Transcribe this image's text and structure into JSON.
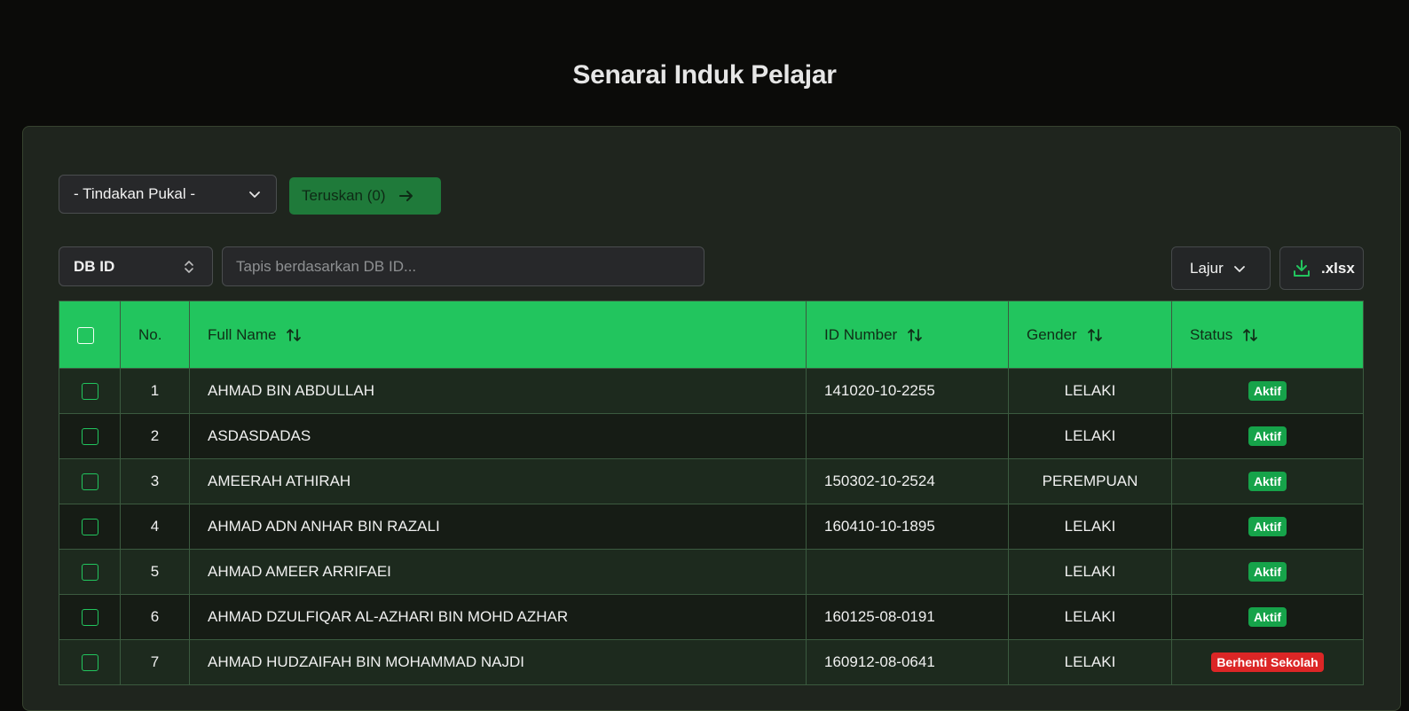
{
  "header": {
    "title": "Senarai Induk Pelajar"
  },
  "bulk": {
    "select_label": "- Tindakan Pukal -",
    "go_label": "Teruskan (0)"
  },
  "filter": {
    "field_label": "DB ID",
    "placeholder": "Tapis berdasarkan DB ID..."
  },
  "toolbar": {
    "columns_label": "Lajur",
    "export_label": ".xlsx"
  },
  "table": {
    "columns": {
      "no": "No.",
      "name": "Full Name",
      "id": "ID Number",
      "gender": "Gender",
      "status": "Status"
    },
    "rows": [
      {
        "no": "1",
        "name": "AHMAD BIN ABDULLAH",
        "id": "141020-10-2255",
        "gender": "LELAKI",
        "status": "Aktif"
      },
      {
        "no": "2",
        "name": "ASDASDADAS",
        "id": "",
        "gender": "LELAKI",
        "status": "Aktif"
      },
      {
        "no": "3",
        "name": "AMEERAH ATHIRAH",
        "id": "150302-10-2524",
        "gender": "PEREMPUAN",
        "status": "Aktif"
      },
      {
        "no": "4",
        "name": "AHMAD ADN ANHAR BIN RAZALI",
        "id": "160410-10-1895",
        "gender": "LELAKI",
        "status": "Aktif"
      },
      {
        "no": "5",
        "name": "AHMAD AMEER ARRIFAEI",
        "id": "",
        "gender": "LELAKI",
        "status": "Aktif"
      },
      {
        "no": "6",
        "name": "AHMAD DZULFIQAR AL-AZHARI BIN MOHD AZHAR",
        "id": "160125-08-0191",
        "gender": "LELAKI",
        "status": "Aktif"
      },
      {
        "no": "7",
        "name": "AHMAD HUDZAIFAH BIN MOHAMMAD NAJDI",
        "id": "160912-08-0641",
        "gender": "LELAKI",
        "status": "Berhenti Sekolah"
      }
    ]
  },
  "colors": {
    "accent": "#22c55e",
    "status_active": "#16a34a",
    "status_stopped": "#dc2626"
  }
}
